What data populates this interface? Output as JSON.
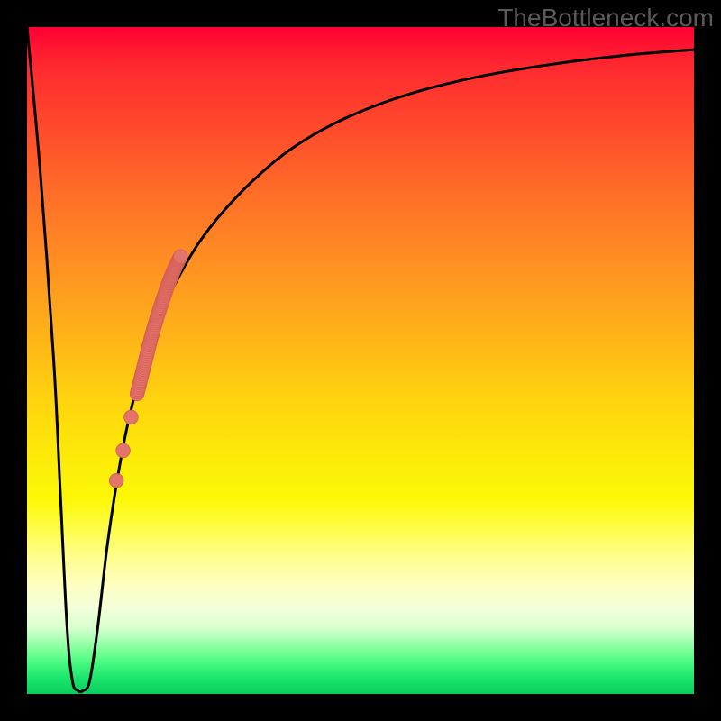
{
  "watermark": {
    "text": "TheBottleneck.com"
  },
  "colors": {
    "frame": "#000000",
    "curve": "#000000",
    "marker_fill": "#e2746c",
    "marker_stroke": "#d65f56",
    "watermark": "#5a5a5a"
  },
  "chart_data": {
    "type": "line",
    "title": "",
    "xlabel": "",
    "ylabel": "",
    "xlim": [
      0,
      100
    ],
    "ylim": [
      0,
      100
    ],
    "grid": false,
    "legend": false,
    "annotations": [
      "TheBottleneck.com"
    ],
    "note": "No axis or tick labels are rendered; values are estimated in a 0–100 normalized space from the image.",
    "series": [
      {
        "name": "bottleneck-curve",
        "x": [
          0,
          2,
          4,
          5,
          6,
          6.8,
          7.6,
          8.4,
          9.4,
          10.6,
          12,
          13.5,
          15,
          17,
          19,
          21,
          23,
          26,
          30,
          35,
          40,
          46,
          53,
          61,
          70,
          80,
          90,
          100
        ],
        "y": [
          100,
          78,
          50,
          30,
          10,
          2,
          0.5,
          0.5,
          2,
          10,
          22,
          32,
          40,
          48,
          54,
          59,
          63,
          68,
          73,
          78,
          82,
          85.5,
          88.5,
          91,
          93,
          94.6,
          95.8,
          96.6
        ]
      },
      {
        "name": "markers-main-band",
        "type": "scatter",
        "x": [
          16.5,
          17.0,
          17.5,
          18.0,
          18.5,
          19.0,
          19.5,
          20.0,
          20.5,
          21.0,
          21.5,
          22.0,
          22.5,
          23.0
        ],
        "y": [
          45.0,
          47.0,
          49.0,
          51.0,
          53.0,
          54.8,
          56.5,
          58.0,
          59.5,
          61.0,
          62.3,
          63.5,
          64.6,
          65.6
        ]
      },
      {
        "name": "markers-lower-dots",
        "type": "scatter",
        "x": [
          13.4,
          14.4,
          15.6
        ],
        "y": [
          32.0,
          36.5,
          41.5
        ]
      }
    ]
  }
}
